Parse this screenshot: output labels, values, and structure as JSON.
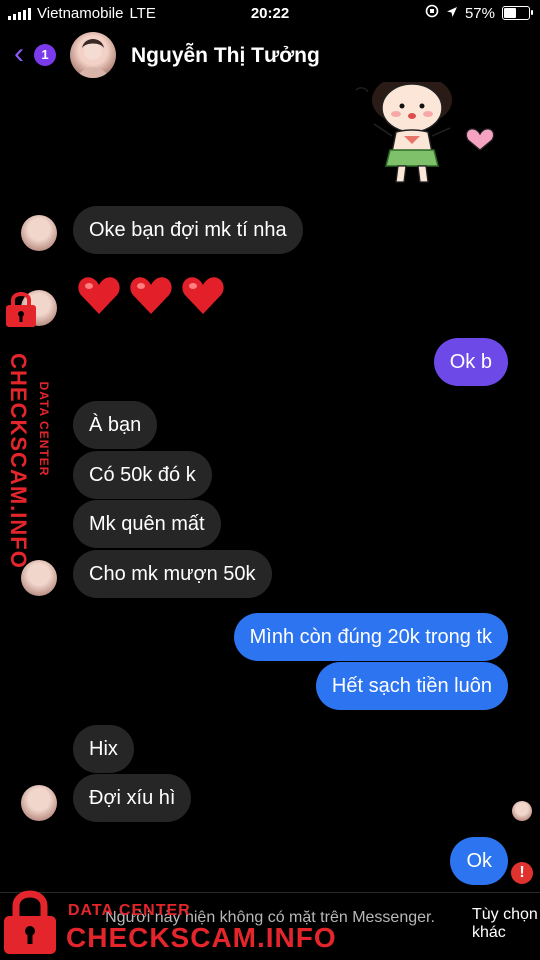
{
  "status_bar": {
    "carrier": "Vietnamobile",
    "network": "LTE",
    "time": "20:22",
    "battery": "57%",
    "battery_level": 0.57
  },
  "header": {
    "back_badge": "1",
    "contact_name": "Nguyễn Thị Tưởng"
  },
  "messages": [
    {
      "side": "in",
      "text": "Oke bạn đợi mk tí nha"
    },
    {
      "side": "in",
      "type": "emoji",
      "text": "❤️❤️❤️"
    },
    {
      "side": "out",
      "text": "Ok b"
    },
    {
      "side": "in",
      "text": "À bạn"
    },
    {
      "side": "in",
      "text": "Có 50k đó k"
    },
    {
      "side": "in",
      "text": "Mk quên mất"
    },
    {
      "side": "in",
      "text": "Cho mk mượn 50k"
    },
    {
      "side": "out",
      "text": "Mình còn đúng 20k trong tk"
    },
    {
      "side": "out",
      "text": "Hết sạch tiền luôn"
    },
    {
      "side": "in",
      "text": "Hix"
    },
    {
      "side": "in",
      "text": "Đợi xíu hì"
    },
    {
      "side": "out",
      "text": "Ok"
    }
  ],
  "footer": {
    "notice": "Người này hiện không có mặt trên Messenger.",
    "options": "Tùy chọn khác"
  },
  "watermark": {
    "small": "DATA CENTER",
    "big": "CHECKSCAM.INFO"
  },
  "colors": {
    "outgoing_blue": "#2d74f0",
    "outgoing_purple": "#6d4ae8",
    "incoming": "#262626",
    "accent": "#7c3aed",
    "watermark_red": "#e4262c"
  }
}
